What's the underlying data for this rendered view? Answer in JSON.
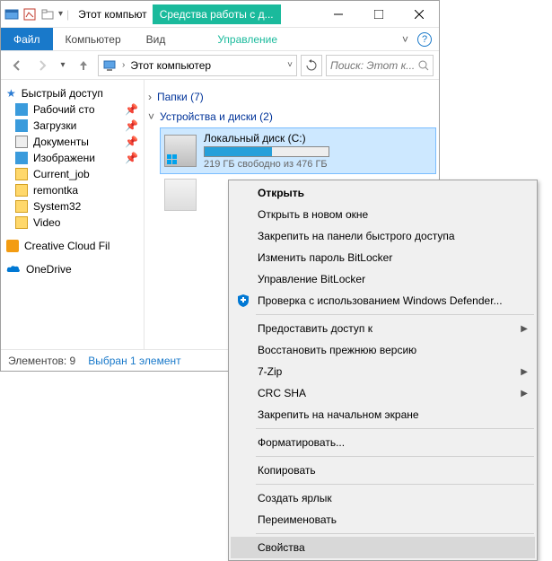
{
  "titlebar": {
    "title": "Этот компьют",
    "context_tab": "Средства работы с д..."
  },
  "ribbon": {
    "file": "Файл",
    "tabs": [
      "Компьютер",
      "Вид"
    ],
    "context_tab": "Управление"
  },
  "addressbar": {
    "location": "Этот компьютер"
  },
  "search": {
    "placeholder": "Поиск: Этот к..."
  },
  "navpane": {
    "quick_access": "Быстрый доступ",
    "items": [
      {
        "label": "Рабочий сто",
        "pinned": true,
        "icon": "desktop"
      },
      {
        "label": "Загрузки",
        "pinned": true,
        "icon": "downloads"
      },
      {
        "label": "Документы",
        "pinned": true,
        "icon": "documents"
      },
      {
        "label": "Изображени",
        "pinned": true,
        "icon": "pictures"
      },
      {
        "label": "Current_job",
        "pinned": false,
        "icon": "folder"
      },
      {
        "label": "remontka",
        "pinned": false,
        "icon": "folder"
      },
      {
        "label": "System32",
        "pinned": false,
        "icon": "folder"
      },
      {
        "label": "Video",
        "pinned": false,
        "icon": "folder"
      }
    ],
    "creative_cloud": "Creative Cloud Fil",
    "onedrive": "OneDrive"
  },
  "content": {
    "group_folders": "Папки (7)",
    "group_drives": "Устройства и диски (2)",
    "drive_c": {
      "name": "Локальный диск (C:)",
      "free": "219 ГБ свободно из 476 ГБ"
    }
  },
  "statusbar": {
    "count": "Элементов: 9",
    "selected": "Выбран 1 элемент"
  },
  "context_menu": {
    "open": "Открыть",
    "open_new": "Открыть в новом окне",
    "pin_quick": "Закрепить на панели быстрого доступа",
    "bitlocker_pwd": "Изменить пароль BitLocker",
    "bitlocker_mgmt": "Управление BitLocker",
    "defender": "Проверка с использованием Windows Defender...",
    "share": "Предоставить доступ к",
    "restore": "Восстановить прежнюю версию",
    "sevenzip": "7-Zip",
    "crcsha": "CRC SHA",
    "pin_start": "Закрепить на начальном экране",
    "format": "Форматировать...",
    "copy": "Копировать",
    "shortcut": "Создать ярлык",
    "rename": "Переименовать",
    "properties": "Свойства"
  }
}
